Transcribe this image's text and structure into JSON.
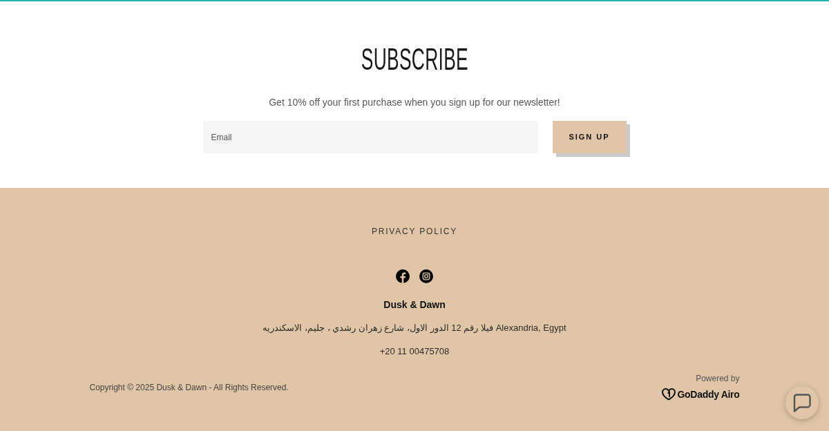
{
  "subscribe": {
    "title": "SUBSCRIBE",
    "text": "Get 10% off your first purchase when you sign up for our newsletter!",
    "email_field": {
      "placeholder": "Email"
    },
    "button": "SIGN UP"
  },
  "footer": {
    "links": [
      "PRIVACY POLICY"
    ],
    "social": [
      {
        "kind": "facebook"
      },
      {
        "kind": "instagram"
      }
    ],
    "business_name": "Dusk & Dawn",
    "address": "فيلا رقم 12 الدور الاول، شارع زهران رشدي ، جليم، الاسكندريه Alexandria, Egypt",
    "phone": "+20 11 00475708",
    "copyright": "Copyright © 2025 Dusk & Dawn - All Rights Reserved.",
    "powered_by": "Powered by",
    "brand": "GoDaddy Airo"
  }
}
